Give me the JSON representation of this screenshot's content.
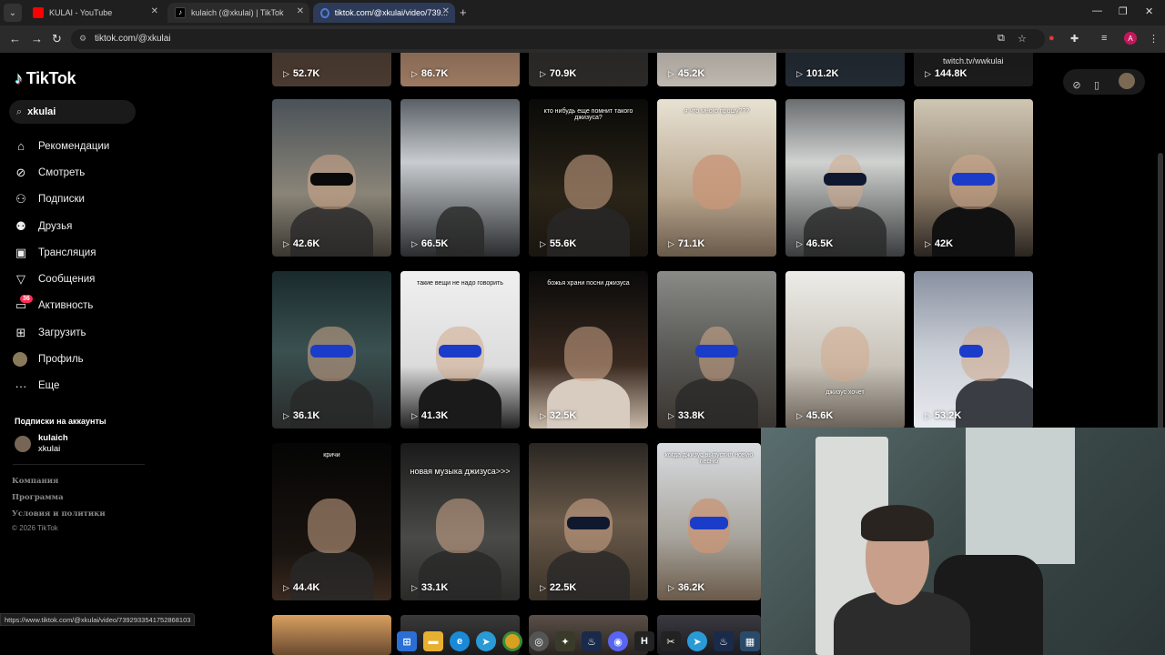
{
  "browser": {
    "tabs": [
      {
        "title": "KULAI - YouTube",
        "icon": "youtube-icon",
        "color": "#ff0000"
      },
      {
        "title": "kulaich (@xkulai) | TikTok",
        "icon": "tiktok-icon",
        "color": "#000000"
      },
      {
        "title": "tiktok.com/@xkulai/video/739...",
        "icon": "loading-icon",
        "color": "#4f7bd6",
        "active": true
      }
    ],
    "new_tab": "+",
    "url": "tiktok.com/@xkulai",
    "status_url": "https://www.tiktok.com/@xkulai/video/7392933541752868103",
    "profile_initial": "A"
  },
  "sidebar": {
    "logo": "TikTok",
    "search_value": "xkulai",
    "items": [
      {
        "label": "Рекомендации",
        "icon": "home-icon"
      },
      {
        "label": "Смотреть",
        "icon": "compass-icon"
      },
      {
        "label": "Подписки",
        "icon": "following-icon"
      },
      {
        "label": "Друзья",
        "icon": "friends-icon"
      },
      {
        "label": "Трансляция",
        "icon": "live-icon"
      },
      {
        "label": "Сообщения",
        "icon": "messages-icon"
      },
      {
        "label": "Активность",
        "icon": "activity-icon",
        "badge": "36"
      },
      {
        "label": "Загрузить",
        "icon": "upload-icon"
      },
      {
        "label": "Профиль",
        "icon": "profile-avatar"
      },
      {
        "label": "Еще",
        "icon": "more-icon"
      }
    ],
    "subscriptions_title": "Подписки на аккаунты",
    "subscription": {
      "name": "kulaich",
      "handle": "xkulai"
    },
    "footer_links": [
      "Компания",
      "Программа",
      "Условия и политики"
    ],
    "copyright": "© 2026 TikTok"
  },
  "overlay_text": "twitch.tv/wwkulai",
  "videos": {
    "row0": [
      "52.7K",
      "86.7K",
      "70.9K",
      "45.2K",
      "101.2K",
      "144.8K"
    ],
    "row1": [
      "42.6K",
      "66.5K",
      "55.6K",
      "71.1K",
      "46.5K",
      "42K"
    ],
    "row2": [
      "36.1K",
      "41.3K",
      "32.5K",
      "33.8K",
      "45.6K",
      "53.2K"
    ],
    "row3": [
      "44.4K",
      "33.1K",
      "22.5K",
      "36.2K"
    ],
    "captions": {
      "r1c2": "кто нибудь еще помнит такого джизуса?",
      "r1c3": "я что много прошу???",
      "r2c1": "такие вещи не надо говорить",
      "r2c2": "божья храни посни джизуса",
      "r2c4": "джизус хочет",
      "r3c0": "кричи",
      "r3c1": "новая музыка джизуса>>>",
      "r3c3": "когда джизус выпустил новую песню"
    }
  },
  "colors": {
    "background": "#000000",
    "accent": "#fe2c55",
    "chrome": "#2b2b2b"
  }
}
